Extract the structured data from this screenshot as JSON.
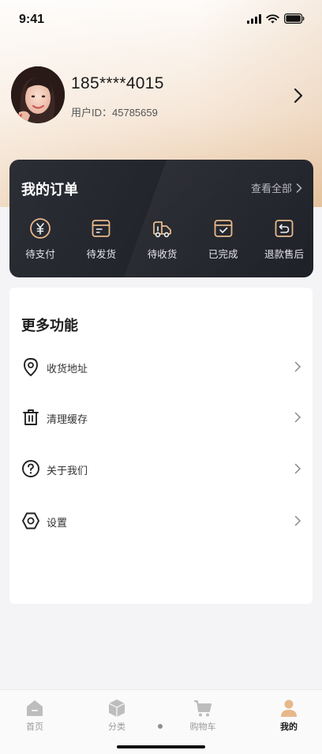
{
  "status_bar": {
    "time": "9:41"
  },
  "profile": {
    "phone": "185****4015",
    "uid_label": "用户ID：",
    "uid_value": "45785659"
  },
  "orders": {
    "title": "我的订单",
    "view_all": "查看全部",
    "items": [
      {
        "label": "待支付",
        "icon": "yen-coin-icon"
      },
      {
        "label": "待发货",
        "icon": "package-box-icon"
      },
      {
        "label": "待收货",
        "icon": "delivery-truck-icon"
      },
      {
        "label": "已完成",
        "icon": "checked-box-icon"
      },
      {
        "label": "退款售后",
        "icon": "return-arrow-icon"
      }
    ]
  },
  "more": {
    "title": "更多功能",
    "items": [
      {
        "label": "收货地址",
        "icon": "location-pin-icon"
      },
      {
        "label": "清理缓存",
        "icon": "trash-icon"
      },
      {
        "label": "关于我们",
        "icon": "question-circle-icon"
      },
      {
        "label": "设置",
        "icon": "settings-hexagon-icon"
      }
    ]
  },
  "tabbar": {
    "items": [
      {
        "label": "首页",
        "icon": "home-icon",
        "active": false
      },
      {
        "label": "分类",
        "icon": "category-box-icon",
        "active": false
      },
      {
        "label": "购物车",
        "icon": "shopping-cart-icon",
        "active": false
      },
      {
        "label": "我的",
        "icon": "user-profile-icon",
        "active": true
      }
    ]
  },
  "colors": {
    "header_gradient_end": "#e9c9a7",
    "orders_card": "#25272e",
    "order_icon_accent": "#e7b98c",
    "active_tab_icon": "#e6b88a"
  }
}
